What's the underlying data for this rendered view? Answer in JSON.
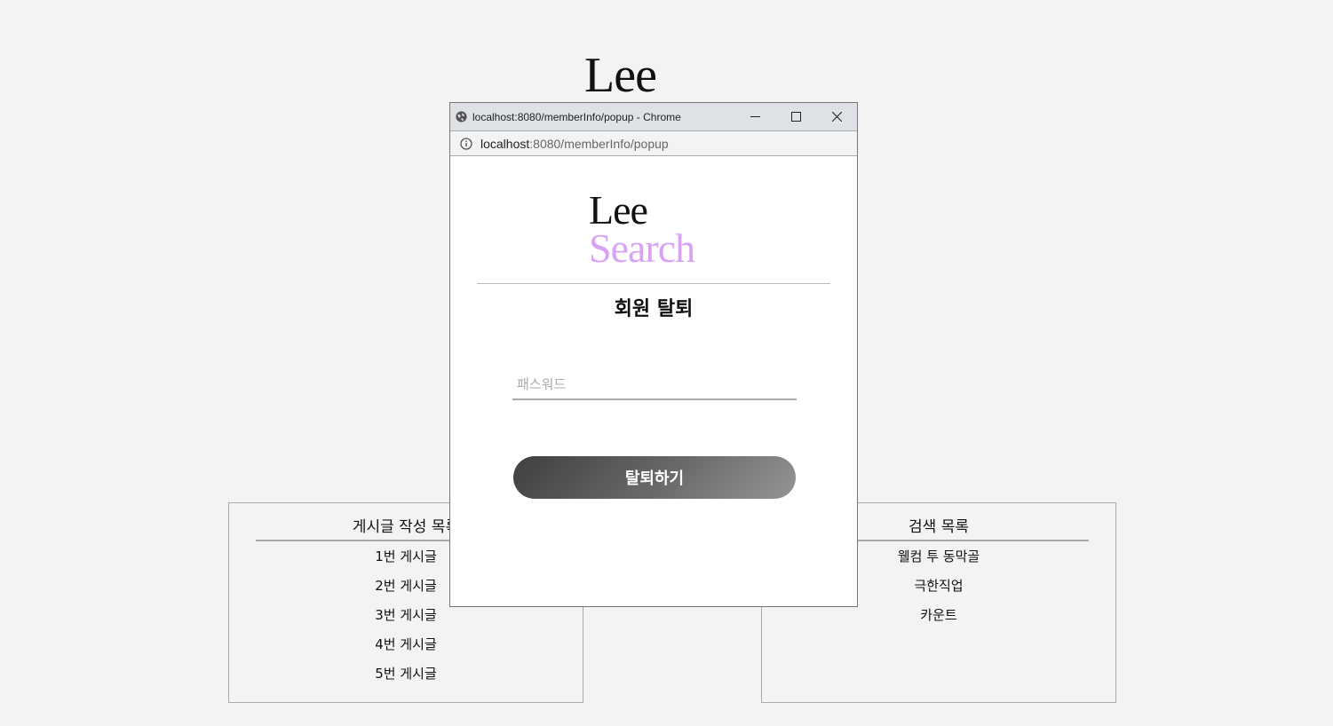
{
  "page": {
    "logo": "Lee",
    "panels": {
      "posts": {
        "title": "게시글 작성 목록",
        "items": [
          "1번 게시글",
          "2번 게시글",
          "3번 게시글",
          "4번 게시글",
          "5번 게시글"
        ]
      },
      "searches": {
        "title": "검색 목록",
        "items": [
          "웰컴 투 동막골",
          "극한직업",
          "카운트"
        ]
      }
    }
  },
  "popup": {
    "window_title": "localhost:8080/memberInfo/popup - Chrome",
    "address_host": "localhost",
    "address_rest": ":8080/memberInfo/popup",
    "logo_line1": "Lee",
    "logo_line2": "Search",
    "logo_accent_color": "#d9a3f5",
    "heading": "회원 탈퇴",
    "password_placeholder": "패스워드",
    "password_value": "",
    "submit_label": "탈퇴하기"
  }
}
